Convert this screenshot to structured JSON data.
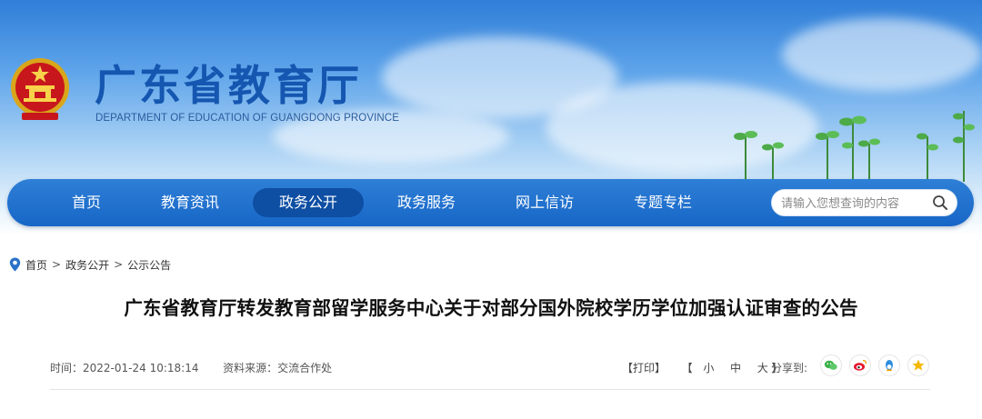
{
  "header": {
    "title": "广东省教育厅",
    "subtitle": "DEPARTMENT OF EDUCATION OF GUANGDONG PROVINCE",
    "emblem_icon": "national-emblem-icon"
  },
  "nav": {
    "items": [
      {
        "label": "首页",
        "active": false
      },
      {
        "label": "教育资讯",
        "active": false
      },
      {
        "label": "政务公开",
        "active": true
      },
      {
        "label": "政务服务",
        "active": false
      },
      {
        "label": "网上信访",
        "active": false
      },
      {
        "label": "专题专栏",
        "active": false
      }
    ],
    "search": {
      "placeholder": "请输入您想查询的内容",
      "value": ""
    }
  },
  "breadcrumb": {
    "items": [
      "首页",
      "政务公开",
      "公示公告"
    ],
    "separator": ">"
  },
  "article": {
    "title": "广东省教育厅转发教育部留学服务中心关于对部分国外院校学历学位加强认证审查的公告",
    "time_label": "时间：",
    "time": "2022-01-24 10:18:14",
    "source_label": "资料来源：",
    "source": "交流合作处"
  },
  "tools": {
    "print": "【打印】",
    "size_open": "【",
    "small": "小",
    "medium": "中",
    "large": "大",
    "size_close": "】",
    "share_label": "分享到:"
  },
  "share": [
    {
      "icon": "wechat-icon",
      "color": "#3bb24a"
    },
    {
      "icon": "weibo-icon",
      "color": "#e6162d"
    },
    {
      "icon": "qq-icon",
      "color": "#2d8ee0"
    },
    {
      "icon": "qzone-icon",
      "color": "#f5b800"
    }
  ],
  "colors": {
    "nav_bg": "#1a6acb",
    "nav_active": "#0e4ea3",
    "title_blue": "#1556b0"
  }
}
